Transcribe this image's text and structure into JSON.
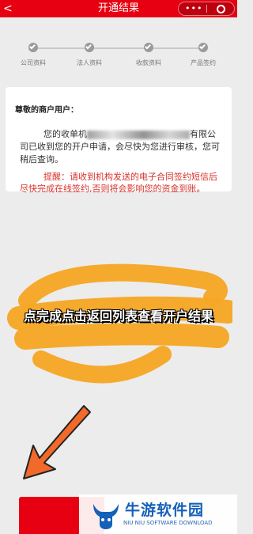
{
  "header": {
    "back_symbol": "<",
    "title": "开通结果",
    "menu_dots": "•••",
    "color": "#e60012"
  },
  "steps": [
    {
      "label": "公司资料",
      "status": "done"
    },
    {
      "label": "法人资料",
      "status": "done"
    },
    {
      "label": "收款资料",
      "status": "done"
    },
    {
      "label": "产品签约",
      "status": "done"
    }
  ],
  "card": {
    "greeting": "尊敬的商户用户：",
    "message_prefix": "您的收单机",
    "message_suffix": "有限公司已收到您的开户申请，会尽快为您进行审核，您可稍后查询。",
    "reminder": "提醒：请收到机构发送的电子合同签约短信后尽快完成在线签约,否则将会影响您的资金到账。",
    "reminder_color": "#d6322c"
  },
  "annotation": {
    "text": "点完成点击返回列表查看开户结果",
    "highlight_color": "#f5a623",
    "arrow_color": "#f26a2a"
  },
  "watermark": {
    "name": "牛游软件园",
    "subtitle": "NIU NIU SOFTWARE DOWNLOAD"
  }
}
